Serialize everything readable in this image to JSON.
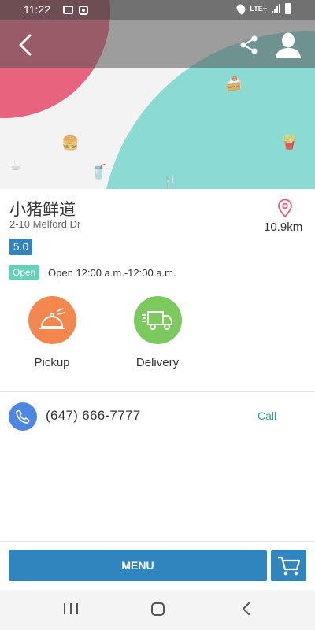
{
  "status_bar": {
    "time": "11:22",
    "network": "LTE+"
  },
  "restaurant": {
    "name": "小猪鲜道",
    "address": "2-10 Melford Dr",
    "distance": "10.9km",
    "rating": "5.0",
    "open_status": "Open",
    "hours": "Open 12:00 a.m.-12:00 a.m."
  },
  "options": [
    {
      "label": "Pickup",
      "icon": "cloche-icon",
      "color": "#f3874e"
    },
    {
      "label": "Delivery",
      "icon": "truck-icon",
      "color": "#7cc95e"
    }
  ],
  "contact": {
    "phone": "(647) 666-7777",
    "call_label": "Call"
  },
  "bottom": {
    "menu_label": "MENU"
  },
  "colors": {
    "primary": "#3085bf",
    "accent_teal": "#8bdbd4",
    "accent_red": "#e8637d",
    "open_green": "#63d2b8"
  }
}
